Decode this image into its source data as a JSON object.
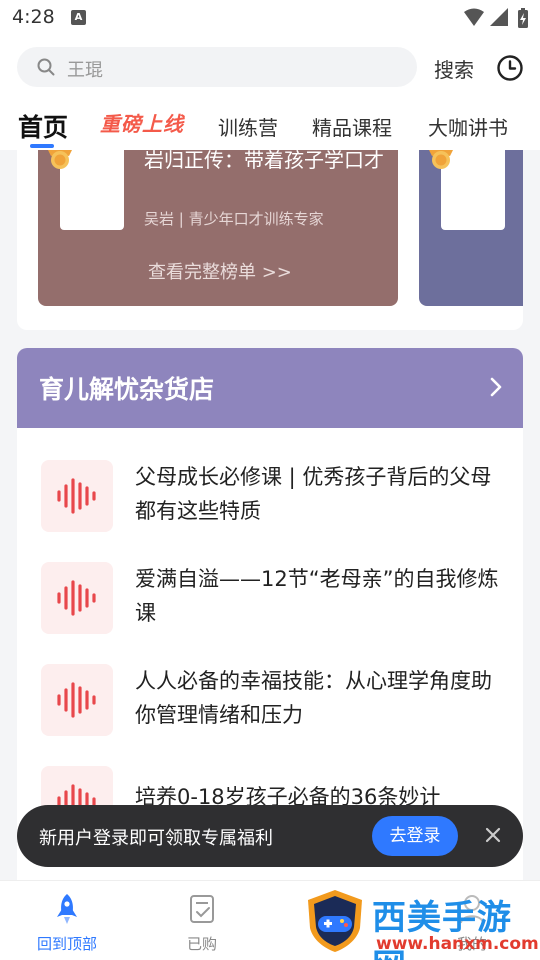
{
  "status": {
    "time": "4:28",
    "notification_letter": "A"
  },
  "search": {
    "placeholder": "王琨",
    "button_label": "搜索"
  },
  "tabs": [
    {
      "label": "首页",
      "active": true
    },
    {
      "label": "重磅上线",
      "promo": true
    },
    {
      "label": "训练营"
    },
    {
      "label": "精品课程"
    },
    {
      "label": "大咖讲书"
    }
  ],
  "ranking": {
    "title": "岩归正传：带着孩子学口才",
    "author": "吴岩 | 青少年口才训练专家",
    "more_label": "查看完整榜单 >>",
    "card_color": "#946e6c",
    "card2_color": "#6d6f9c"
  },
  "section": {
    "title": "育儿解忧杂货店",
    "header_color": "#8e85bd",
    "items": [
      {
        "title": "父母成长必修课 | 优秀孩子背后的父母都有这些特质"
      },
      {
        "title": "爱满自溢——12节“老母亲”的自我修炼课"
      },
      {
        "title": "人人必备的幸福技能：从心理学角度助你管理情绪和压力"
      },
      {
        "title": "培养0-18岁孩子必备的36条妙计"
      }
    ]
  },
  "login_banner": {
    "text": "新用户登录即可领取专属福利",
    "button_label": "去登录"
  },
  "bottom_nav": [
    {
      "label": "回到顶部",
      "active": true
    },
    {
      "label": "已购"
    },
    {
      "label": "我的"
    }
  ],
  "watermark": {
    "title": "西美手游网",
    "url": "www.hanxm.com"
  },
  "colors": {
    "accent": "#2f79ff",
    "promo": "#f45a4a",
    "audio": "#e8474b"
  }
}
